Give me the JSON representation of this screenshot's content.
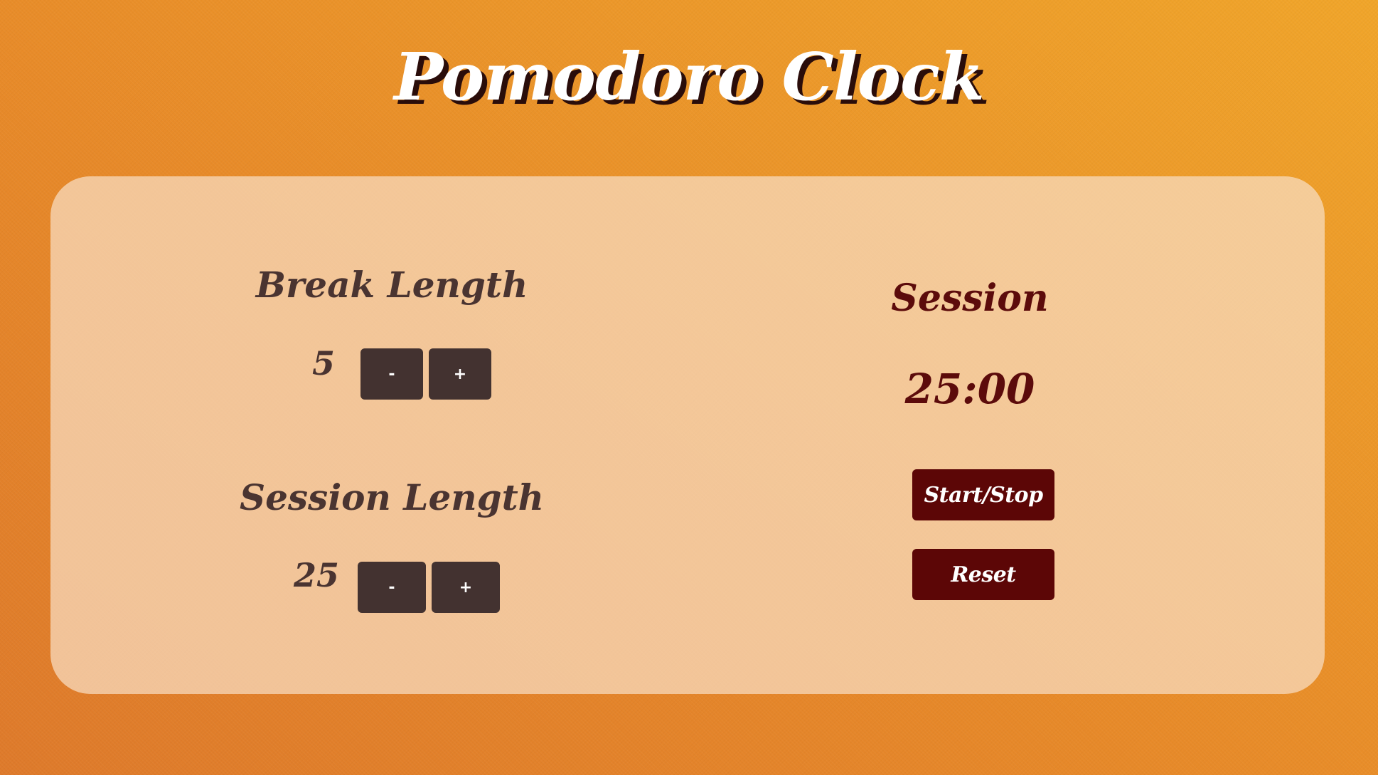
{
  "title": "Pomodoro Clock",
  "break_setting": {
    "label": "Break Length",
    "value": "5",
    "decrement_label": "-",
    "increment_label": "+"
  },
  "session_setting": {
    "label": "Session Length",
    "value": "25",
    "decrement_label": "-",
    "increment_label": "+"
  },
  "timer": {
    "label": "Session",
    "time": "25:00"
  },
  "controls": {
    "start_stop_label": "Start/Stop",
    "reset_label": "Reset"
  },
  "colors": {
    "background_start": "#de7a2b",
    "background_end": "#f0a52a",
    "panel": "#f8dec4",
    "setting_text": "#4a3431",
    "setting_button": "#433230",
    "timer_text": "#5c0b0b",
    "action_button": "#5c0606"
  }
}
